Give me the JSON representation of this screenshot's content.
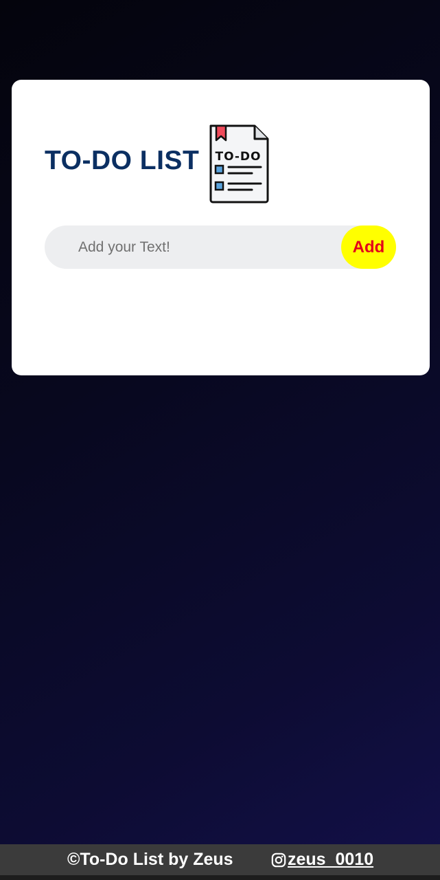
{
  "card": {
    "title": "TO-DO LIST",
    "icon": "todo-document-icon",
    "icon_label": "TO-DO"
  },
  "input": {
    "placeholder": "Add your Text!",
    "value": ""
  },
  "add_button": {
    "label": "Add"
  },
  "footer": {
    "credit": "©To-Do List by Zeus",
    "instagram_handle": "zeus_0010",
    "instagram_icon": "instagram-icon"
  },
  "colors": {
    "title": "#0b2f62",
    "add_button_bg": "#ffff00",
    "add_button_text": "#e3001b",
    "input_bg": "#edeef0",
    "footer_bg": "#3b3b3b"
  }
}
